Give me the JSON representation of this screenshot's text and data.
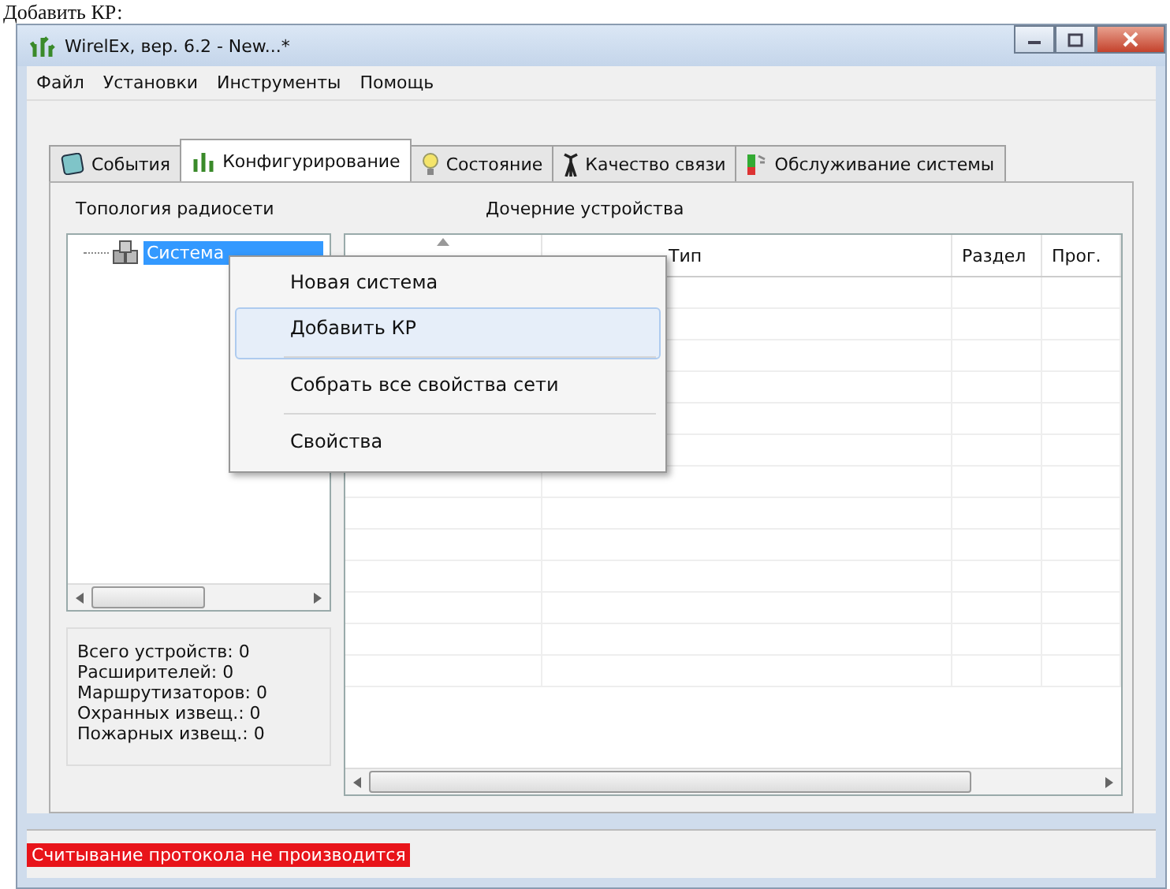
{
  "caption": "Добавить КР:",
  "window": {
    "title": "WirelEx, вер. 6.2 - New...*"
  },
  "menu": [
    "Файл",
    "Установки",
    "Инструменты",
    "Помощь"
  ],
  "tabs": [
    {
      "label": "События",
      "kind": "events",
      "selected": false
    },
    {
      "label": "Конфигурирование",
      "kind": "config",
      "selected": true
    },
    {
      "label": "Состояние",
      "kind": "state",
      "selected": false
    },
    {
      "label": "Качество связи",
      "kind": "quality",
      "selected": false
    },
    {
      "label": "Обслуживание системы",
      "kind": "service",
      "selected": false
    }
  ],
  "topology": {
    "title": "Топология радиосети",
    "tree": [
      {
        "label": "Система",
        "selected": true
      }
    ]
  },
  "stats": [
    "Всего устройств: 0",
    "Расширителей: 0",
    "Маршрутизаторов: 0",
    "Охранных извещ.: 0",
    "Пожарных извещ.: 0"
  ],
  "devices": {
    "title": "Дочерние устройства",
    "columns": [
      {
        "sorted": true
      },
      {
        "label": "Тип",
        "sorted": false
      },
      {
        "label": "Раздел",
        "sorted": false
      },
      {
        "label": "Прог.",
        "sorted": false
      }
    ]
  },
  "context_menu": [
    {
      "label": "Новая система",
      "selected": false,
      "separator_after": false
    },
    {
      "label": "Добавить КР",
      "selected": true,
      "separator_after": true
    },
    {
      "label": "Собрать все свойства сети",
      "selected": false,
      "separator_after": true
    },
    {
      "label": "Свойства",
      "selected": false,
      "separator_after": false
    }
  ],
  "status_bar": {
    "message": "Считывание протокола не производится",
    "error": true
  }
}
